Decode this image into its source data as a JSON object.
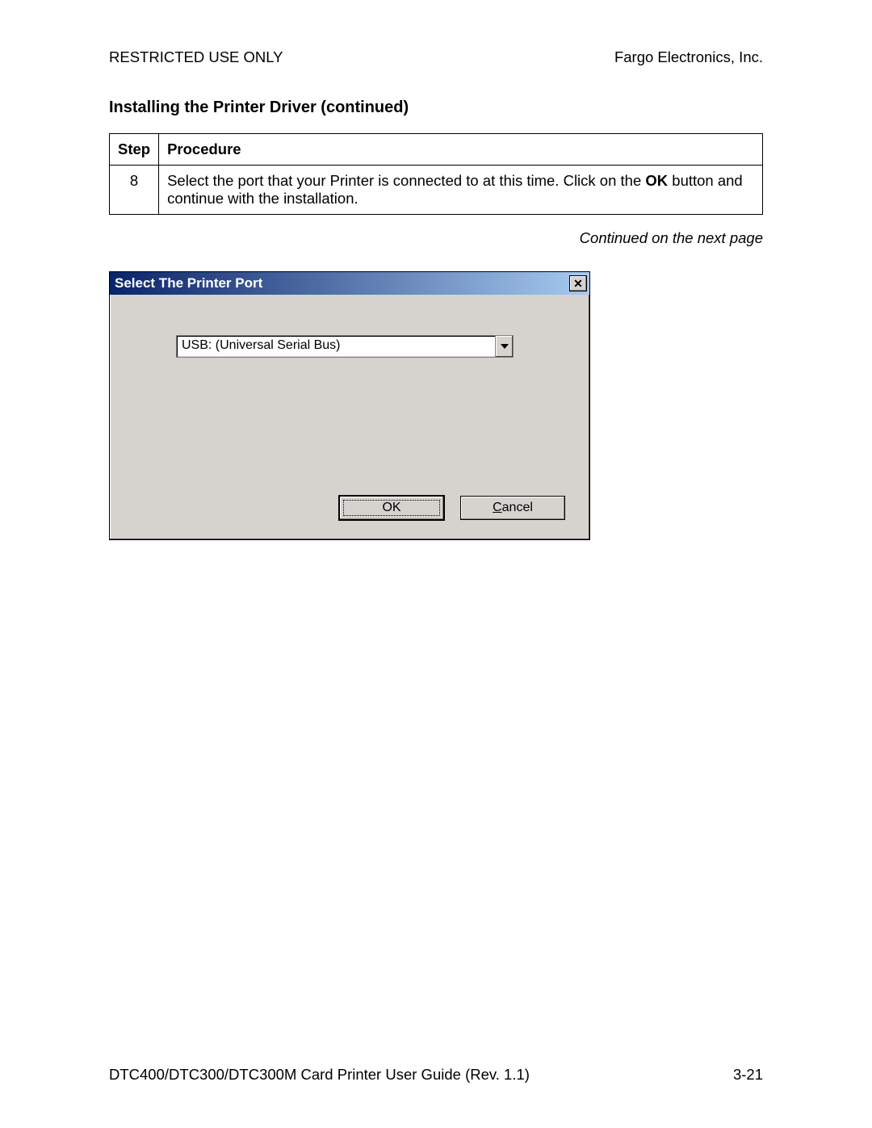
{
  "header": {
    "left": "RESTRICTED USE ONLY",
    "right": "Fargo Electronics, Inc."
  },
  "section_title": "Installing the Printer Driver (continued)",
  "table": {
    "head_step": "Step",
    "head_proc": "Procedure",
    "row_step": "8",
    "row_proc_pre": "Select the port that your Printer is connected to at this time. Click on the ",
    "row_proc_bold": "OK",
    "row_proc_post": " button and continue with the installation."
  },
  "continued": "Continued on the next page",
  "dialog": {
    "title": "Select The Printer Port",
    "combo_value": "USB: (Universal Serial Bus)",
    "ok_label": "OK",
    "cancel_prefix": "C",
    "cancel_rest": "ancel"
  },
  "footer": {
    "left": "DTC400/DTC300/DTC300M Card Printer User Guide (Rev. 1.1)",
    "right": "3-21"
  }
}
